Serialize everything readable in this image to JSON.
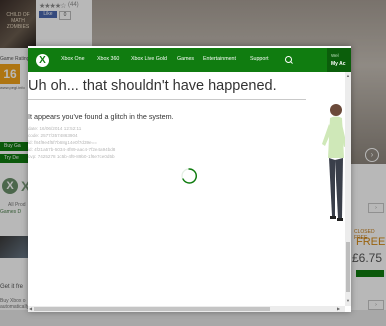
{
  "background": {
    "boxart_text": "CHILD OF MATH ZOMBIES",
    "stars": "★★★★☆",
    "star_count": "(44)",
    "like_label": "Like",
    "like_count": "0",
    "rating_label": "Game Rating",
    "pegi": "16",
    "pegi_sub": "www.pegi.info",
    "side_buttons": [
      "Buy ▸",
      "Try ▸"
    ],
    "side_buttons_short": [
      "Buy Ga",
      "Try De"
    ],
    "allprod": "All Prod",
    "games_d": "Games D",
    "getit": "Get it fre",
    "buytext": "Buy Xbox o automatically download the",
    "gold_label": "CLOSED FREE",
    "free": "FREE",
    "price": "£6.75",
    "see_all": "›"
  },
  "dialog": {
    "nav": {
      "items": [
        "Xbox One",
        "Xbox 360",
        "Xbox Live Gold",
        "Games",
        "Entertainment",
        "Support"
      ],
      "account_line1": "Wel",
      "account_line2": "My Ac"
    },
    "title": "Uh oh... that shouldn't have happened.",
    "description": "It appears you've found a glitch in the system.",
    "diagnostics": [
      "date: 16/06/2014 12:52:11",
      "code: 2577/3574863904",
      "id:   f84f9e4f5f7b68g14e0f7d39e==",
      "id:   4f21a57b-5034-4f89-aac4-7f2e4a94bd8",
      "cvp:  7425278 1c5b-4f9-89b0-1f6e7ce0d5b"
    ]
  },
  "colors": {
    "xbox_green": "#107c10",
    "gold_orange": "#d58a16"
  }
}
